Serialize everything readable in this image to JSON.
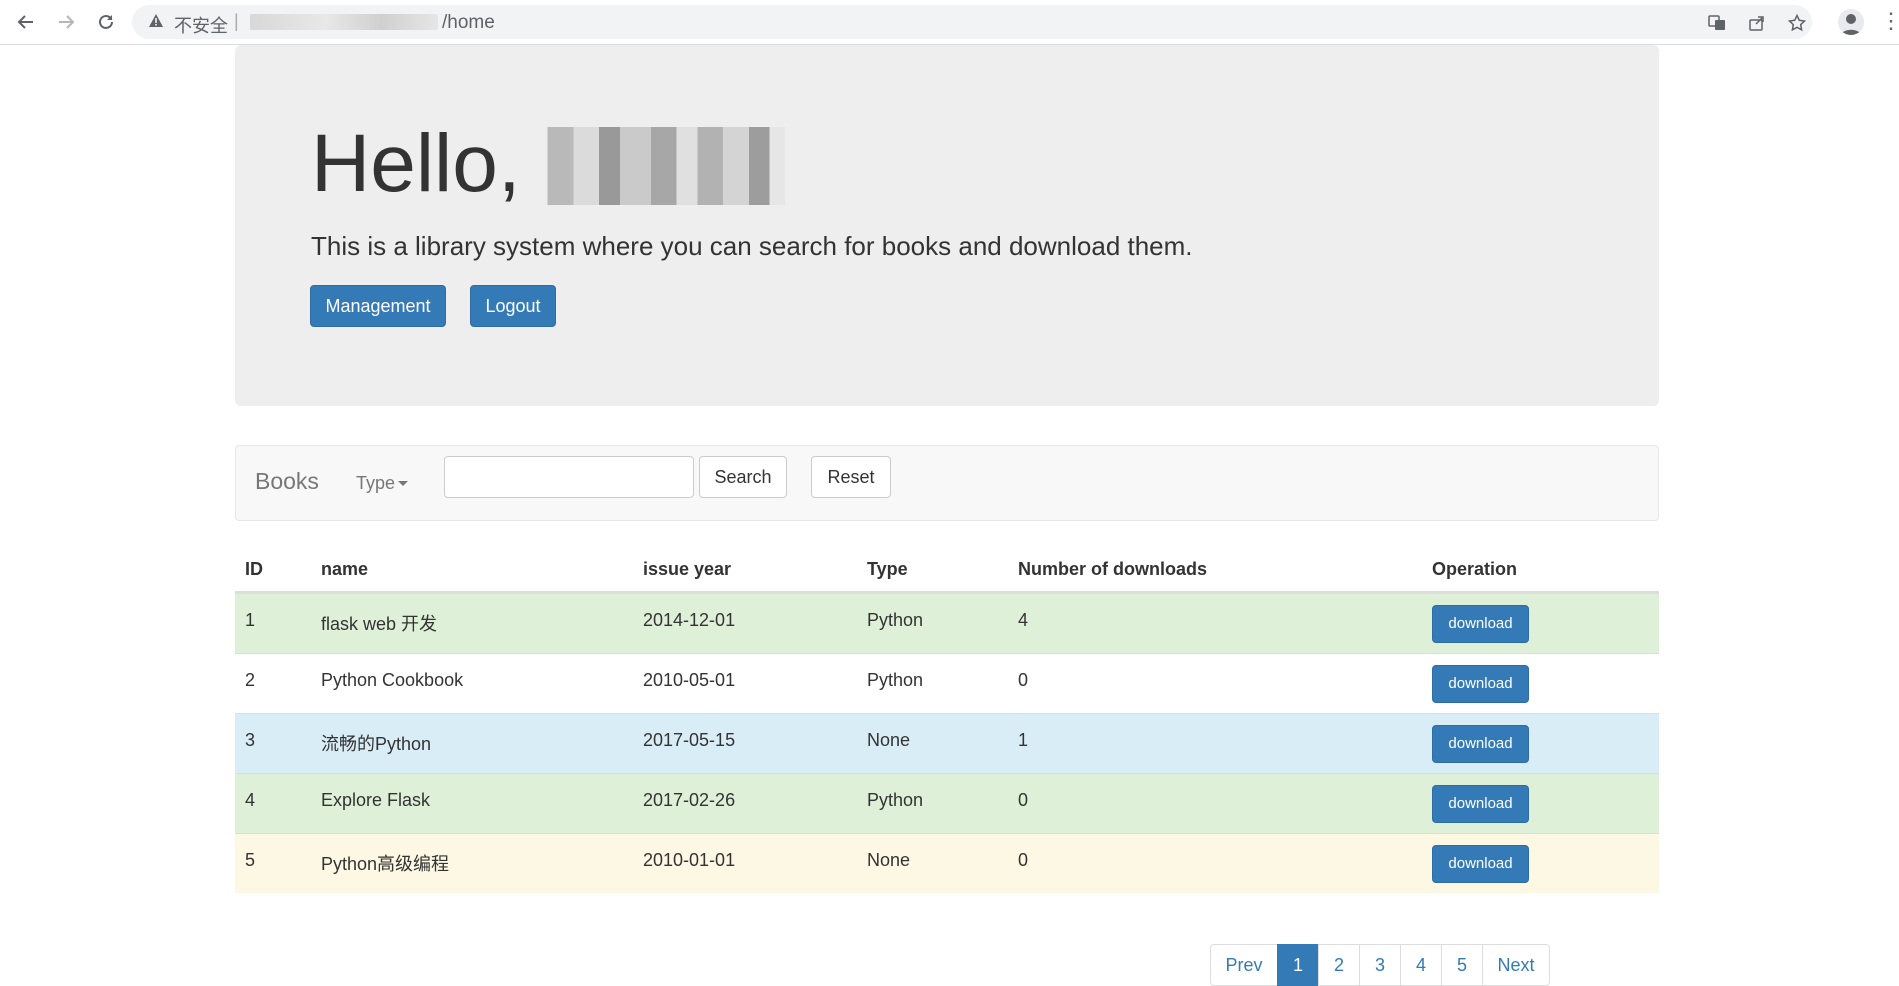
{
  "browser": {
    "security_label": "不安全",
    "separator": "|",
    "url_path": "/home"
  },
  "jumbotron": {
    "greeting": "Hello,",
    "lead": "This is a library system where you can search for books and download them.",
    "management_label": "Management",
    "logout_label": "Logout"
  },
  "navbar": {
    "brand": "Books",
    "type_dropdown": "Type",
    "search_value": "",
    "search_label": "Search",
    "reset_label": "Reset"
  },
  "table": {
    "headers": [
      "ID",
      "name",
      "issue year",
      "Type",
      "Number of downloads",
      "Operation"
    ],
    "rows": [
      {
        "id": "1",
        "name": "flask web 开发",
        "year": "2014-12-01",
        "type": "Python",
        "downloads": "4",
        "action": "download",
        "bg": "#dff0d8"
      },
      {
        "id": "2",
        "name": "Python Cookbook",
        "year": "2010-05-01",
        "type": "Python",
        "downloads": "0",
        "action": "download",
        "bg": "#ffffff"
      },
      {
        "id": "3",
        "name": "流畅的Python",
        "year": "2017-05-15",
        "type": "None",
        "downloads": "1",
        "action": "download",
        "bg": "#d9edf7"
      },
      {
        "id": "4",
        "name": "Explore Flask",
        "year": "2017-02-26",
        "type": "Python",
        "downloads": "0",
        "action": "download",
        "bg": "#dff0d8"
      },
      {
        "id": "5",
        "name": "Python高级编程",
        "year": "2010-01-01",
        "type": "None",
        "downloads": "0",
        "action": "download",
        "bg": "#fcf8e3"
      }
    ]
  },
  "pagination": {
    "prev": "Prev",
    "pages": [
      "1",
      "2",
      "3",
      "4",
      "5"
    ],
    "active": "1",
    "next": "Next"
  },
  "colors": {
    "primary": "#337ab7",
    "jumbotron_bg": "#eeeeee"
  }
}
